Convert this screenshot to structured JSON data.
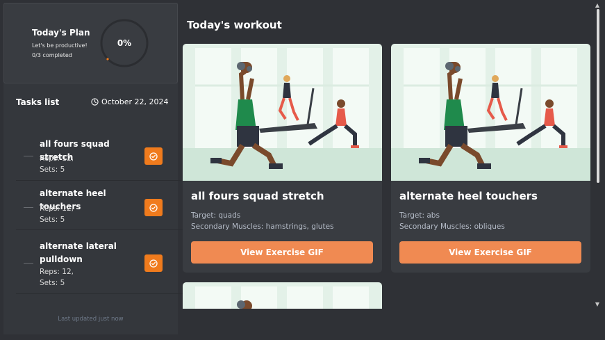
{
  "plan": {
    "title": "Today's Plan",
    "subtitle": "Let's be productive!",
    "completed_text": "0/3 completed",
    "percent_label": "0%",
    "percent_value": 0
  },
  "tasks": {
    "header": "Tasks list",
    "date": "October 22, 2024",
    "items": [
      {
        "name": "all fours squad stretch",
        "reps": "Reps: 12,",
        "sets": "Sets: 5"
      },
      {
        "name": "alternate heel touchers",
        "reps": "Reps: 12,",
        "sets": "Sets: 5"
      },
      {
        "name": "alternate lateral pulldown",
        "reps": "Reps: 12,",
        "sets": "Sets: 5"
      }
    ],
    "last_updated": "Last updated just now"
  },
  "main": {
    "title": "Today's workout",
    "cards": [
      {
        "title": "all fours squad stretch",
        "target": "Target: quads",
        "secondary": "Secondary Muscles: hamstrings, glutes",
        "button": "View Exercise GIF"
      },
      {
        "title": "alternate heel touchers",
        "target": "Target: abs",
        "secondary": "Secondary Muscles: obliques",
        "button": "View Exercise GIF"
      }
    ]
  },
  "colors": {
    "accent": "#f07b1d",
    "button": "#f08a52",
    "background": "#2f3136",
    "card": "#393c41",
    "illustration_bg": "#d9ede3"
  },
  "icons": {
    "clock": "clock-icon",
    "check": "check-circle-icon",
    "illustration": "gym-workout-illustration"
  }
}
